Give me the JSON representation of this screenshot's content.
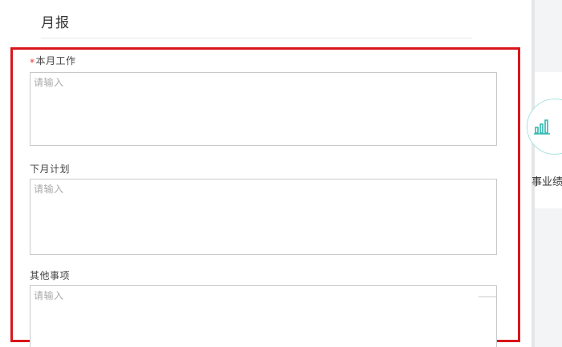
{
  "header": {
    "title": "月报"
  },
  "form": {
    "fields": [
      {
        "label": "本月工作",
        "required": true,
        "placeholder": "请输入"
      },
      {
        "label": "下月计划",
        "required": false,
        "placeholder": "请输入"
      },
      {
        "label": "其他事项",
        "required": false,
        "placeholder": "请输入"
      }
    ],
    "required_marker": "*"
  },
  "side_panel": {
    "icon": "bar-chart-icon",
    "label": "事业绩",
    "accent_color": "#31b7b0"
  },
  "colors": {
    "highlight": "#d9161b",
    "required": "#e53935"
  }
}
